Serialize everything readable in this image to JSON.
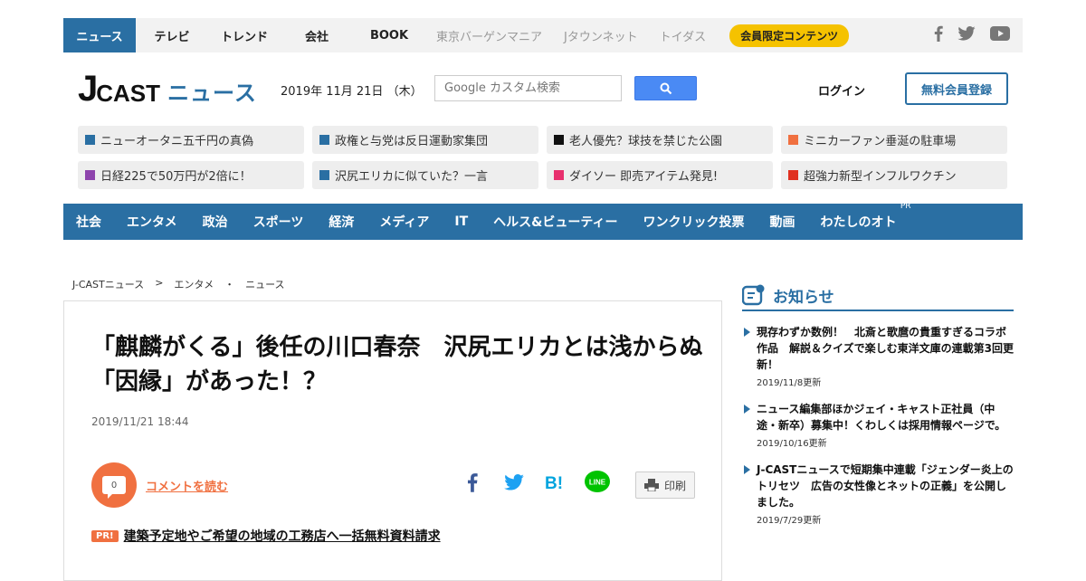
{
  "topnav": {
    "items": [
      "ニュース",
      "テレビ",
      "トレンド",
      "会社",
      "BOOK"
    ],
    "sister_sites": [
      "東京バーゲンマニア",
      "Jタウンネット",
      "トイダス"
    ],
    "member_pill": "会員限定コンテンツ",
    "social_icons": [
      "facebook-icon",
      "twitter-icon",
      "youtube-icon"
    ]
  },
  "header": {
    "logo_j": "J",
    "logo_cast": "CAST",
    "logo_news": "ニュース",
    "date": "2019年 11月 21日 （木）",
    "search_placeholder": "Google カスタム検索",
    "login": "ログイン",
    "register": "無料会員登録"
  },
  "chips": [
    {
      "label": "ニューオータニ五千円の真偽",
      "color": "#2a6fa3"
    },
    {
      "label": "政権と与党は反日運動家集団",
      "color": "#2a6fa3"
    },
    {
      "label": "老人優先？球技を禁じた公園",
      "color": "#111111"
    },
    {
      "label": "ミニカーファン垂涎の駐車場",
      "color": "#f07040"
    },
    {
      "label": "日経225で50万円が2倍に！",
      "color": "#8e44ad"
    },
    {
      "label": "沢尻エリカに似ていた？一言",
      "color": "#2a6fa3"
    },
    {
      "label": "ダイソー 即売アイテム発見!",
      "color": "#e8306e"
    },
    {
      "label": "超強力新型インフルワクチン",
      "color": "#e03020"
    }
  ],
  "mainnav": {
    "items": [
      "社会",
      "エンタメ",
      "政治",
      "スポーツ",
      "経済",
      "メディア",
      "IT",
      "ヘルス&ビューティー",
      "ワンクリック投票",
      "動画",
      "わたしのオト"
    ],
    "pr_tag": "PR"
  },
  "breadcrumb": [
    "J-CASTニュース",
    ">",
    "エンタメ",
    "・",
    "ニュース"
  ],
  "article": {
    "title": "「麒麟がくる」後任の川口春奈　沢尻エリカとは浅からぬ「因縁」があった！？",
    "date": "2019/11/21 18:44",
    "comment_count": "0",
    "comment_link": "コメントを読む",
    "print": "印刷",
    "pr_badge": "PR!",
    "pr_link": "建築予定地やご希望の地域の工務店へ一括無料資料請求"
  },
  "sidebar": {
    "heading": "お知らせ",
    "notices": [
      {
        "text": "現存わずか数例！　北斎と歌麿の貴重すぎるコラボ作品　解説＆クイズで楽しむ東洋文庫の連載第3回更新！",
        "date": "2019/11/8更新"
      },
      {
        "text": "ニュース編集部ほかジェイ・キャスト正社員（中途・新卒）募集中！くわしくは採用情報ページで。",
        "date": "2019/10/16更新"
      },
      {
        "text": "J-CASTニュースで短期集中連載「ジェンダー炎上のトリセツ　広告の女性像とネットの正義」を公開しました。",
        "date": "2019/7/29更新"
      }
    ]
  },
  "colors": {
    "brand_blue": "#2a6fa3",
    "accent_orange": "#f07040",
    "pill_yellow": "#f5c200"
  }
}
